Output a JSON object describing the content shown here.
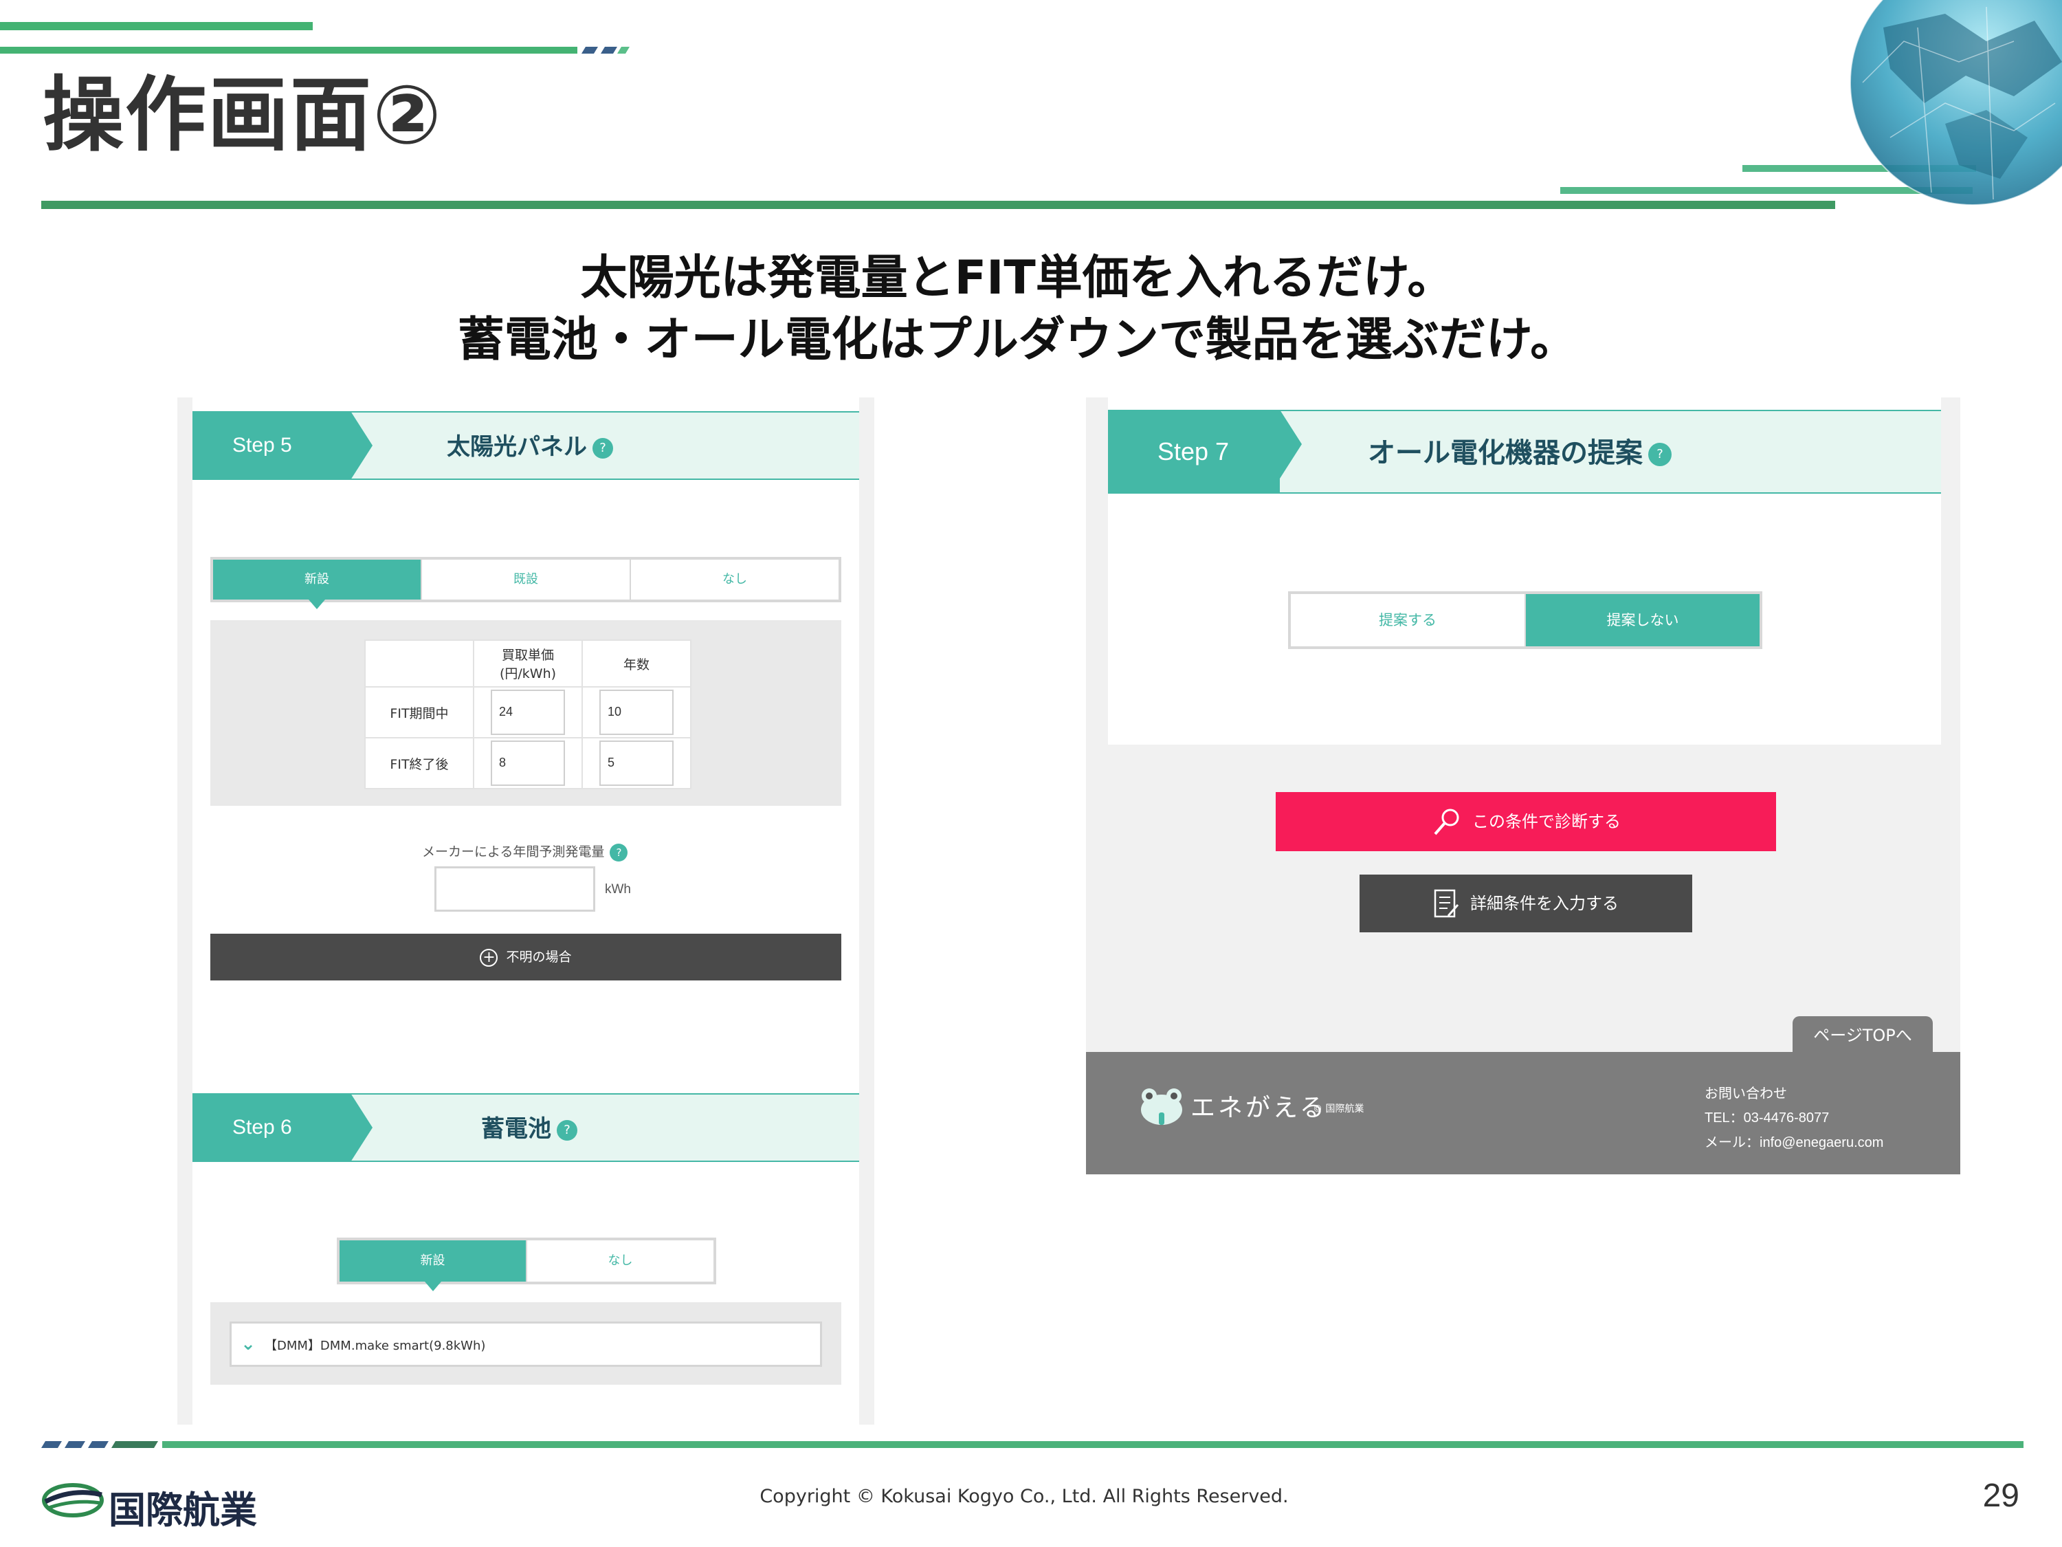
{
  "slide": {
    "title": "操作画面②",
    "headline_line1": "太陽光は発電量とFIT単価を入れるだけ。",
    "headline_line2": "蓄電池・オール電化はプルダウンで製品を選ぶだけ。",
    "copyright": "Copyright © Kokusai Kogyo Co., Ltd. All Rights Reserved.",
    "page_number": "29",
    "company_logo_text": "国際航業",
    "accent_color": "#44b8a6"
  },
  "step5": {
    "step_label": "Step 5",
    "title": "太陽光パネル",
    "help": "?",
    "options": [
      "新設",
      "既設",
      "なし"
    ],
    "selected": "新設",
    "table_header_price": "買取単価(円/kWh)",
    "table_header_years": "年数",
    "row1_label": "FIT期間中",
    "row1_price": "24",
    "row1_years": "10",
    "row2_label": "FIT終了後",
    "row2_price": "8",
    "row2_years": "5",
    "maker_label": "メーカーによる年間予測発電量",
    "unit": "kWh",
    "unknown_button": "不明の場合"
  },
  "step6": {
    "step_label": "Step 6",
    "title": "蓄電池",
    "help": "?",
    "options": [
      "新設",
      "なし"
    ],
    "selected": "新設",
    "product_select": "【DMM】DMM.make smart(9.8kWh)"
  },
  "step7": {
    "step_label": "Step 7",
    "title": "オール電化機器の提案",
    "help": "?",
    "options": [
      "提案する",
      "提案しない"
    ],
    "selected": "提案しない",
    "diagnose_button": "この条件で診断する",
    "detail_button": "詳細条件を入力する",
    "page_top": "ページTOPへ"
  },
  "site_footer": {
    "logo": "エネがえる",
    "logo_sub": "© 国際航業",
    "contact_heading": "お問い合わせ",
    "tel": "TEL：03-4476-8077",
    "mail": "メール：info@enegaeru.com"
  }
}
